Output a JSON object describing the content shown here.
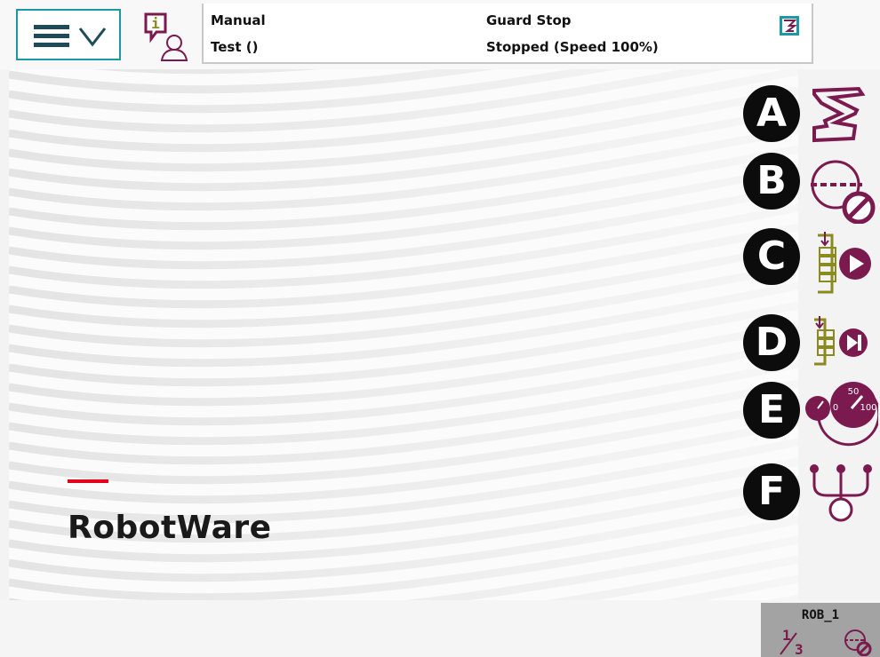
{
  "status": {
    "mode": "Manual",
    "program": "Test ()",
    "safety_state": "Guard Stop",
    "run_state": "Stopped (Speed 100%)"
  },
  "brand": {
    "name": "RobotWare"
  },
  "quickset": [
    {
      "letter": "A",
      "icon": "mechanical-unit-icon"
    },
    {
      "letter": "B",
      "icon": "incremental-off-icon"
    },
    {
      "letter": "C",
      "icon": "run-mode-continuous-icon"
    },
    {
      "letter": "D",
      "icon": "step-mode-icon"
    },
    {
      "letter": "E",
      "icon": "speed-icon"
    },
    {
      "letter": "F",
      "icon": "tasks-icon"
    }
  ],
  "task_panel": {
    "unit_name": "ROB_1",
    "fraction_numerator": "1",
    "fraction_denominator": "3"
  },
  "colors": {
    "accent_teal": "#1b9aa6",
    "icon_maroon": "#7a1a4e",
    "icon_olive": "#8a8a1e",
    "brand_red": "#e2001a"
  }
}
